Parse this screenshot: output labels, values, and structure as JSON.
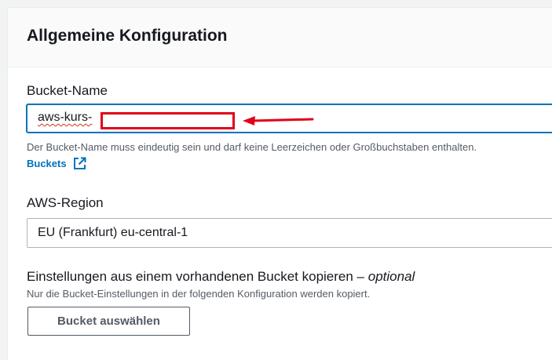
{
  "section": {
    "title": "Allgemeine Konfiguration"
  },
  "bucket_name": {
    "label": "Bucket-Name",
    "value": "aws-kurs-",
    "hint": "Der Bucket-Name muss eindeutig sein und darf keine Leerzeichen oder Großbuchstaben enthalten.",
    "link_label": "Buckets",
    "link_icon": "external-link-icon"
  },
  "annotation": {
    "redaction_color": "#e2001a",
    "arrow_icon": "arrow-left-icon"
  },
  "region": {
    "label": "AWS-Region",
    "selected": "EU (Frankfurt) eu-central-1"
  },
  "copy_settings": {
    "label": "Einstellungen aus einem vorhandenen Bucket kopieren –",
    "optional": "optional",
    "hint": "Nur die Bucket-Einstellungen in der folgenden Konfiguration werden kopiert.",
    "button_label": "Bucket auswählen"
  },
  "colors": {
    "accent": "#0073bb",
    "text": "#16191f",
    "muted": "#545b64"
  }
}
